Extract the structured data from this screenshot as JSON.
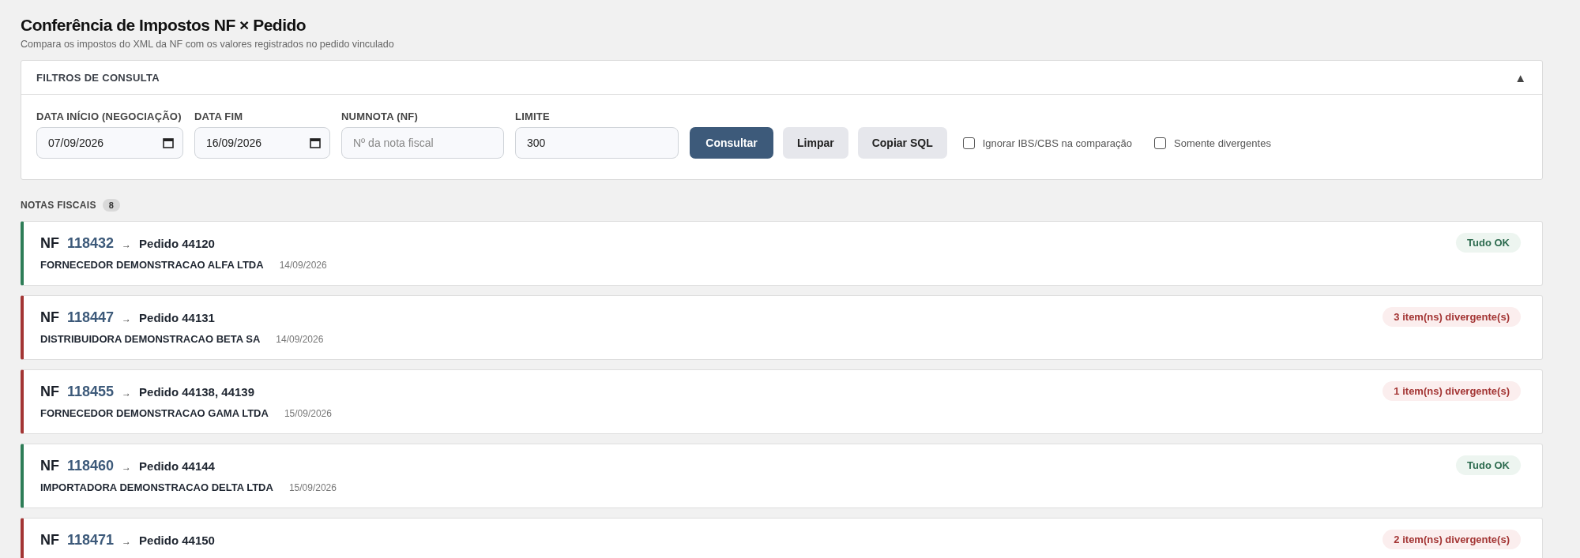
{
  "header": {
    "title": "Conferência de Impostos NF × Pedido",
    "subtitle": "Compara os impostos do XML da NF com os valores registrados no pedido vinculado"
  },
  "filters": {
    "title": "FILTROS DE CONSULTA",
    "toggle": "▲",
    "fields": [
      {
        "kind": "date",
        "label": "DATA INÍCIO (NEGOCIAÇÃO)",
        "value": "07/09/2026"
      },
      {
        "kind": "date",
        "label": "DATA FIM",
        "value": "16/09/2026"
      },
      {
        "kind": "text",
        "label": "NUMNOTA (NF)",
        "placeholder": "Nº da nota fiscal"
      },
      {
        "kind": "text",
        "label": "LIMITE",
        "value": "300"
      }
    ],
    "buttons": [
      {
        "label": "Consultar",
        "kind": "primary"
      },
      {
        "label": "Limpar",
        "kind": "secondary"
      },
      {
        "label": "Copiar SQL",
        "kind": "secondary"
      }
    ],
    "checkboxes": [
      {
        "label": "Ignorar IBS/CBS na comparação",
        "checked": false
      },
      {
        "label": "Somente divergentes",
        "checked": false
      }
    ]
  },
  "list": {
    "title": "NOTAS FISCAIS",
    "count": "8",
    "invoices": [
      {
        "prefix": "NF",
        "number": "118432",
        "arrow": "→",
        "order": "Pedido 44120",
        "supplier": "FORNECEDOR DEMONSTRACAO ALFA LTDA",
        "date": "14/09/2026",
        "kind": "ok",
        "status": "Tudo OK"
      },
      {
        "prefix": "NF",
        "number": "118447",
        "arrow": "→",
        "order": "Pedido 44131",
        "supplier": "DISTRIBUIDORA DEMONSTRACAO BETA SA",
        "date": "14/09/2026",
        "kind": "divergent",
        "status": "3 item(ns) divergente(s)"
      },
      {
        "prefix": "NF",
        "number": "118455",
        "arrow": "→",
        "order": "Pedido 44138, 44139",
        "supplier": "FORNECEDOR DEMONSTRACAO GAMA LTDA",
        "date": "15/09/2026",
        "kind": "divergent",
        "status": "1 item(ns) divergente(s)"
      },
      {
        "prefix": "NF",
        "number": "118460",
        "arrow": "→",
        "order": "Pedido 44144",
        "supplier": "IMPORTADORA DEMONSTRACAO DELTA LTDA",
        "date": "15/09/2026",
        "kind": "ok",
        "status": "Tudo OK"
      },
      {
        "prefix": "NF",
        "number": "118471",
        "arrow": "→",
        "order": "Pedido 44150",
        "kind": "divergent",
        "status": "2 item(ns) divergente(s)"
      }
    ]
  }
}
